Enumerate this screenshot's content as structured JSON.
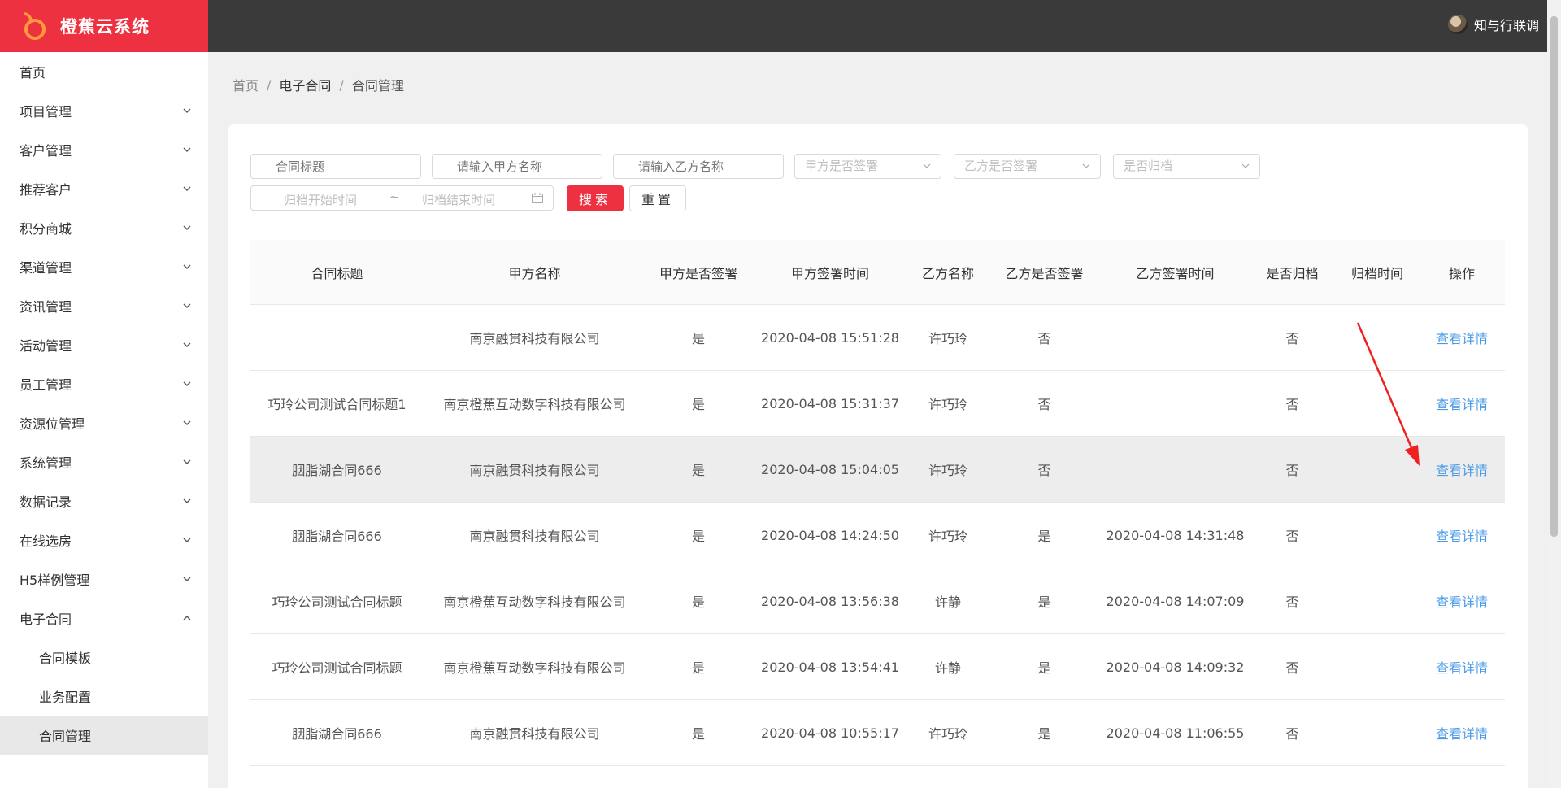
{
  "app": {
    "name": "橙蕉云系统"
  },
  "header": {
    "user_name": "知与行联调"
  },
  "sidebar": {
    "items": [
      {
        "label": "首页",
        "has_children": false
      },
      {
        "label": "项目管理",
        "has_children": true
      },
      {
        "label": "客户管理",
        "has_children": true
      },
      {
        "label": "推荐客户",
        "has_children": true
      },
      {
        "label": "积分商城",
        "has_children": true
      },
      {
        "label": "渠道管理",
        "has_children": true
      },
      {
        "label": "资讯管理",
        "has_children": true
      },
      {
        "label": "活动管理",
        "has_children": true
      },
      {
        "label": "员工管理",
        "has_children": true
      },
      {
        "label": "资源位管理",
        "has_children": true
      },
      {
        "label": "系统管理",
        "has_children": true
      },
      {
        "label": "数据记录",
        "has_children": true
      },
      {
        "label": "在线选房",
        "has_children": true
      },
      {
        "label": "H5样例管理",
        "has_children": true
      },
      {
        "label": "电子合同",
        "has_children": true,
        "expanded": true
      }
    ],
    "subitems": [
      {
        "label": "合同模板"
      },
      {
        "label": "业务配置"
      },
      {
        "label": "合同管理",
        "active": true
      }
    ]
  },
  "breadcrumb": {
    "home": "首页",
    "parent": "电子合同",
    "current": "合同管理",
    "separator": "/"
  },
  "filters": {
    "title_placeholder": "合同标题",
    "party_a_placeholder": "请输入甲方名称",
    "party_b_placeholder": "请输入乙方名称",
    "party_a_signed_placeholder": "甲方是否签署",
    "party_b_signed_placeholder": "乙方是否签署",
    "archived_placeholder": "是否归档",
    "archive_start_placeholder": "归档开始时间",
    "range_separator": "~",
    "archive_end_placeholder": "归档结束时间",
    "search_label": "搜索",
    "reset_label": "重置"
  },
  "table": {
    "columns": [
      "合同标题",
      "甲方名称",
      "甲方是否签署",
      "甲方签署时间",
      "乙方名称",
      "乙方是否签署",
      "乙方签署时间",
      "是否归档",
      "归档时间",
      "操作"
    ],
    "rows": [
      {
        "title": "",
        "party_a": "南京融贯科技有限公司",
        "a_signed": "是",
        "a_time": "2020-04-08 15:51:28",
        "party_b": "许巧玲",
        "b_signed": "否",
        "b_time": "",
        "archived": "否",
        "archive_time": "",
        "action": "查看详情"
      },
      {
        "title": "巧玲公司测试合同标题1",
        "party_a": "南京橙蕉互动数字科技有限公司",
        "a_signed": "是",
        "a_time": "2020-04-08 15:31:37",
        "party_b": "许巧玲",
        "b_signed": "否",
        "b_time": "",
        "archived": "否",
        "archive_time": "",
        "action": "查看详情"
      },
      {
        "title": "胭脂湖合同666",
        "party_a": "南京融贯科技有限公司",
        "a_signed": "是",
        "a_time": "2020-04-08 15:04:05",
        "party_b": "许巧玲",
        "b_signed": "否",
        "b_time": "",
        "archived": "否",
        "archive_time": "",
        "action": "查看详情"
      },
      {
        "title": "胭脂湖合同666",
        "party_a": "南京融贯科技有限公司",
        "a_signed": "是",
        "a_time": "2020-04-08 14:24:50",
        "party_b": "许巧玲",
        "b_signed": "是",
        "b_time": "2020-04-08 14:31:48",
        "archived": "否",
        "archive_time": "",
        "action": "查看详情"
      },
      {
        "title": "巧玲公司测试合同标题",
        "party_a": "南京橙蕉互动数字科技有限公司",
        "a_signed": "是",
        "a_time": "2020-04-08 13:56:38",
        "party_b": "许静",
        "b_signed": "是",
        "b_time": "2020-04-08 14:07:09",
        "archived": "否",
        "archive_time": "",
        "action": "查看详情"
      },
      {
        "title": "巧玲公司测试合同标题",
        "party_a": "南京橙蕉互动数字科技有限公司",
        "a_signed": "是",
        "a_time": "2020-04-08 13:54:41",
        "party_b": "许静",
        "b_signed": "是",
        "b_time": "2020-04-08 14:09:32",
        "archived": "否",
        "archive_time": "",
        "action": "查看详情"
      },
      {
        "title": "胭脂湖合同666",
        "party_a": "南京融贯科技有限公司",
        "a_signed": "是",
        "a_time": "2020-04-08 10:55:17",
        "party_b": "许巧玲",
        "b_signed": "是",
        "b_time": "2020-04-08 11:06:55",
        "archived": "否",
        "archive_time": "",
        "action": "查看详情"
      }
    ]
  },
  "colors": {
    "brand": "#ee3140",
    "header_bg": "#3a3a3a",
    "link": "#4a9ae8",
    "annotation_arrow": "#ee2020"
  }
}
